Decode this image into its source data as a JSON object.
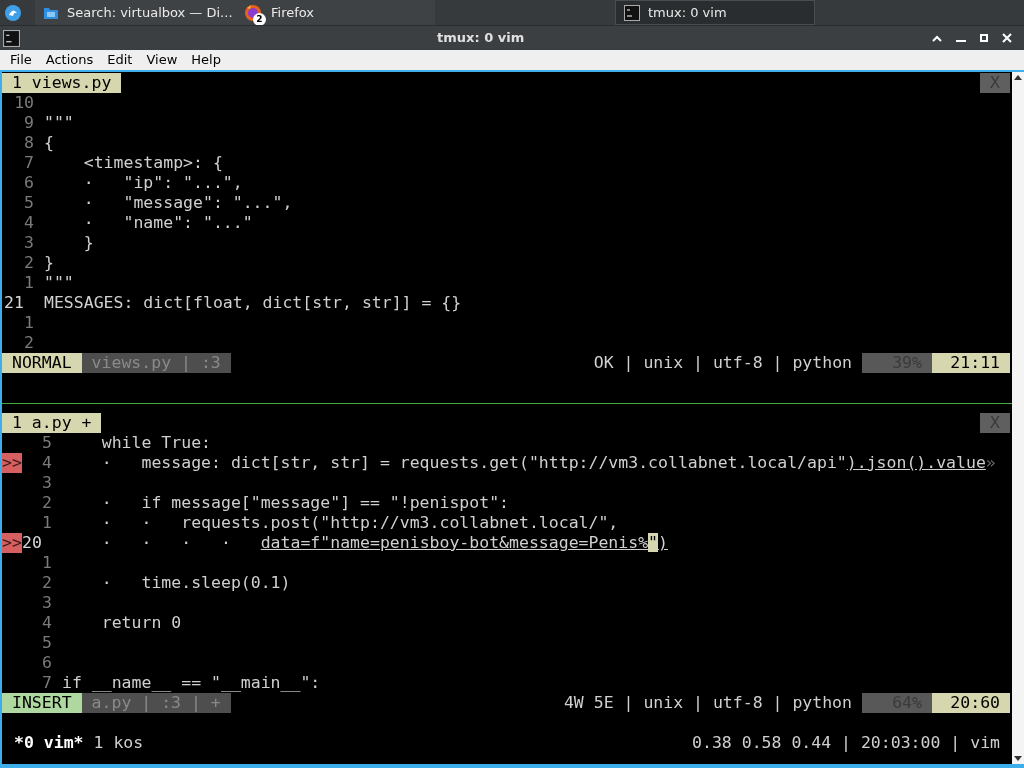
{
  "taskbar": {
    "tasks": [
      {
        "label": "Search: virtualbox — Di...",
        "selected": false
      },
      {
        "label": "Firefox",
        "badge": "2",
        "selected": false
      },
      {
        "label": "tmux: 0 vim",
        "selected": true
      }
    ]
  },
  "window": {
    "title": "tmux: 0 vim"
  },
  "menu": [
    "File",
    "Actions",
    "Edit",
    "View",
    "Help"
  ],
  "panes": [
    {
      "tab": "1 views.py",
      "close": "X",
      "lines": [
        {
          "number": "10",
          "current": false
        },
        {
          "number": "9",
          "current": false,
          "segments": [
            {
              "text": "\"\"\"",
              "kind": "plain"
            }
          ]
        },
        {
          "number": "8",
          "current": false,
          "segments": [
            {
              "text": "{",
              "kind": "plain"
            }
          ]
        },
        {
          "number": "7",
          "current": false,
          "segments": [
            {
              "text": "    <timestamp>: {",
              "kind": "plain"
            }
          ]
        },
        {
          "number": "6",
          "current": false,
          "segments": [
            {
              "text": "    ·   \"ip\": \"...\",",
              "kind": "plain"
            }
          ]
        },
        {
          "number": "5",
          "current": false,
          "segments": [
            {
              "text": "    ·   \"message\": \"...\",",
              "kind": "plain"
            }
          ]
        },
        {
          "number": "4",
          "current": false,
          "segments": [
            {
              "text": "    ·   \"name\": \"...\"",
              "kind": "plain"
            }
          ]
        },
        {
          "number": "3",
          "current": false,
          "segments": [
            {
              "text": "    }",
              "kind": "plain"
            }
          ]
        },
        {
          "number": "2",
          "current": false,
          "segments": [
            {
              "text": "}",
              "kind": "plain"
            }
          ]
        },
        {
          "number": "1",
          "current": false,
          "segments": [
            {
              "text": "\"\"\"",
              "kind": "plain"
            }
          ]
        },
        {
          "number": "21",
          "current": true,
          "segments": [
            {
              "text": "MESSAGES: dict[float, dict[str, str]] = {}",
              "kind": "plain"
            }
          ]
        },
        {
          "number": "1",
          "current": false
        },
        {
          "number": "2",
          "current": false
        }
      ],
      "status": {
        "mode": "NORMAL",
        "file_info": "views.py | :3",
        "right": "OK | unix | utf-8 | python",
        "percent": "39%",
        "position": "21:11"
      }
    },
    {
      "tab": "1 a.py +",
      "close": "X",
      "lines": [
        {
          "number": "5",
          "current": false,
          "segments": [
            {
              "text": "    while True:",
              "kind": "plain"
            }
          ]
        },
        {
          "sign": ">>",
          "number": "4",
          "current": false,
          "segments": [
            {
              "text": "    ·   message: dict[str, str] = requests.get(\"http://vm3.collabnet.local/api\"",
              "kind": "plain"
            },
            {
              "text": ").json().value",
              "kind": "underline"
            },
            {
              "text": "»",
              "kind": "dim"
            }
          ]
        },
        {
          "number": "3",
          "current": false
        },
        {
          "number": "2",
          "current": false,
          "segments": [
            {
              "text": "    ·   if message[\"message\"] == \"!penispot\":",
              "kind": "plain"
            }
          ]
        },
        {
          "number": "1",
          "current": false,
          "segments": [
            {
              "text": "    ·   ·   requests.post(\"http://vm3.collabnet.local/\",",
              "kind": "plain"
            }
          ]
        },
        {
          "sign": ">>",
          "number": "20",
          "current": true,
          "segments": [
            {
              "text": "    ·   ·   ·   ·   ",
              "kind": "plain"
            },
            {
              "text": "data=f\"name=penisboy-bot&message=Penis%",
              "kind": "underline"
            },
            {
              "text": "\"",
              "kind": "cursor"
            },
            {
              "text": ")",
              "kind": "underline"
            }
          ]
        },
        {
          "number": "1",
          "current": false
        },
        {
          "number": "2",
          "current": false,
          "segments": [
            {
              "text": "    ·   time.sleep(0.1)",
              "kind": "plain"
            }
          ]
        },
        {
          "number": "3",
          "current": false
        },
        {
          "number": "4",
          "current": false,
          "segments": [
            {
              "text": "    return 0",
              "kind": "plain"
            }
          ]
        },
        {
          "number": "5",
          "current": false
        },
        {
          "number": "6",
          "current": false
        },
        {
          "number": "7",
          "current": false,
          "segments": [
            {
              "text": "if __name__ == \"__main__\":",
              "kind": "plain"
            }
          ]
        }
      ],
      "status": {
        "mode": "INSERT",
        "file_info": "a.py | :3 | +",
        "right": "4W 5E | unix | utf-8 | python",
        "percent": "64%",
        "position": "20:60"
      }
    }
  ],
  "tmux": {
    "active_window": "*0 vim*",
    "other_window": "1 kos",
    "right": "0.38 0.58 0.44 | 20:03:00 | vim"
  }
}
